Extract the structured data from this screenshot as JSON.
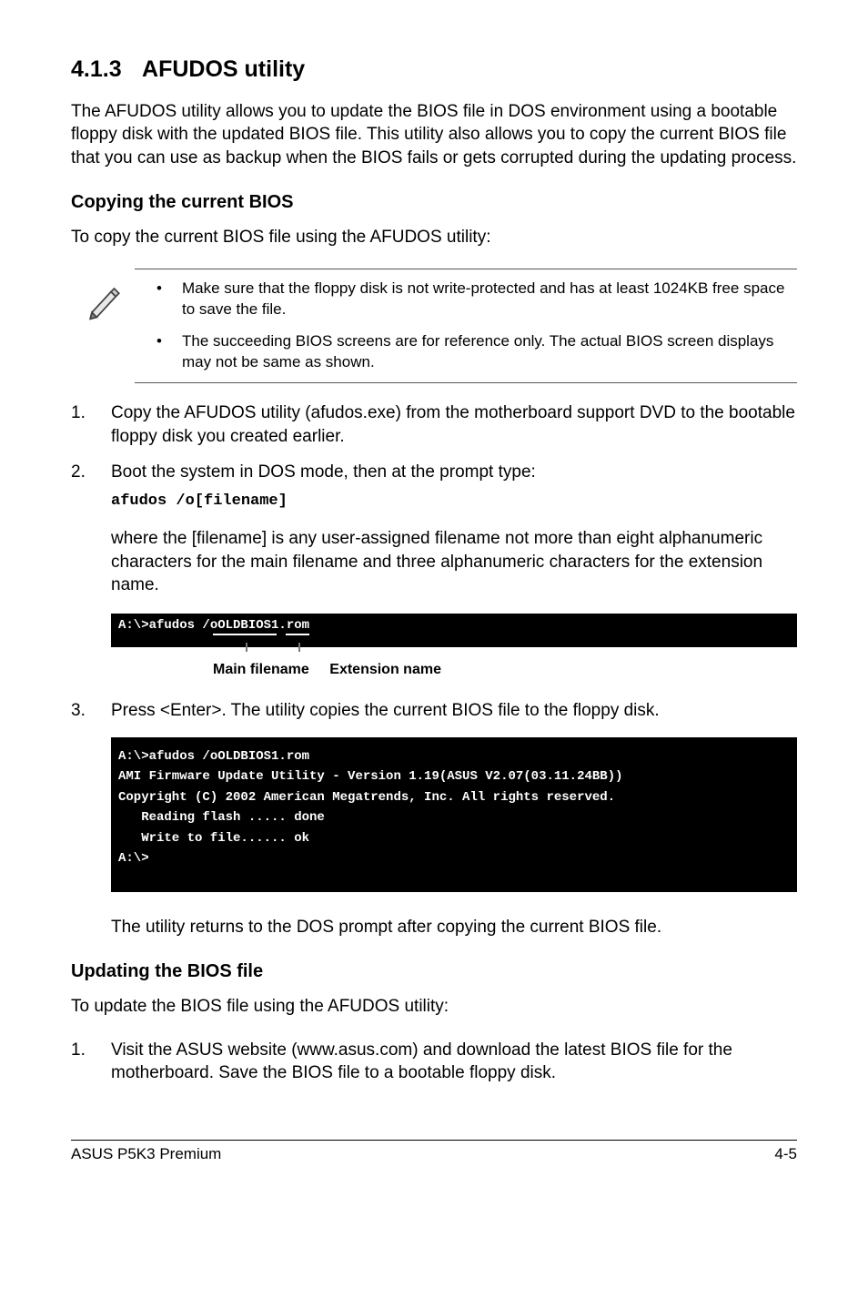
{
  "section": {
    "number": "4.1.3",
    "title": "AFUDOS utility"
  },
  "intro": "The AFUDOS utility allows you to update the BIOS file in DOS environment using a bootable floppy disk with the updated BIOS file. This utility also allows you to copy the current BIOS file that you can use as backup when the BIOS fails or gets corrupted during the updating process.",
  "copy_section": {
    "heading": "Copying the current BIOS",
    "lead": "To copy the current BIOS file using the AFUDOS utility:",
    "notes": [
      "Make sure that the floppy disk is not write-protected and has at least 1024KB free space to save the file.",
      "The succeeding BIOS screens are for reference only. The actual BIOS screen displays may not be same as shown."
    ],
    "steps": [
      {
        "num": "1.",
        "text": "Copy the AFUDOS utility (afudos.exe) from the motherboard support DVD to the bootable floppy disk you created earlier."
      },
      {
        "num": "2.",
        "text": "Boot the system in DOS mode, then at the prompt type:"
      }
    ],
    "cmd": "afudos /o[filename]",
    "where_text": "where the [filename] is any user-assigned filename not more than eight alphanumeric characters  for the main filename and three alphanumeric characters for the extension name.",
    "terminal1": "A:\\>afudos /oOLDBIOS1.rom",
    "filename_labels": {
      "main": "Main filename",
      "ext": "Extension name"
    },
    "step3": {
      "num": "3.",
      "text": "Press <Enter>. The utility copies the current BIOS file to the floppy disk."
    },
    "terminal2": [
      "A:\\>afudos /oOLDBIOS1.rom",
      "AMI Firmware Update Utility - Version 1.19(ASUS V2.07(03.11.24BB))",
      "Copyright (C) 2002 American Megatrends, Inc. All rights reserved.",
      "   Reading flash ..... done",
      "   Write to file...... ok",
      "A:\\>"
    ],
    "after_copy": "The utility returns to the DOS prompt after copying the current BIOS file."
  },
  "update_section": {
    "heading": "Updating the BIOS file",
    "lead": "To update the BIOS file using the AFUDOS utility:",
    "steps": [
      {
        "num": "1.",
        "text": "Visit the ASUS website (www.asus.com) and download the latest BIOS file for the motherboard. Save the BIOS file to a bootable floppy disk."
      }
    ]
  },
  "footer": {
    "left": "ASUS P5K3 Premium",
    "right": "4-5"
  }
}
